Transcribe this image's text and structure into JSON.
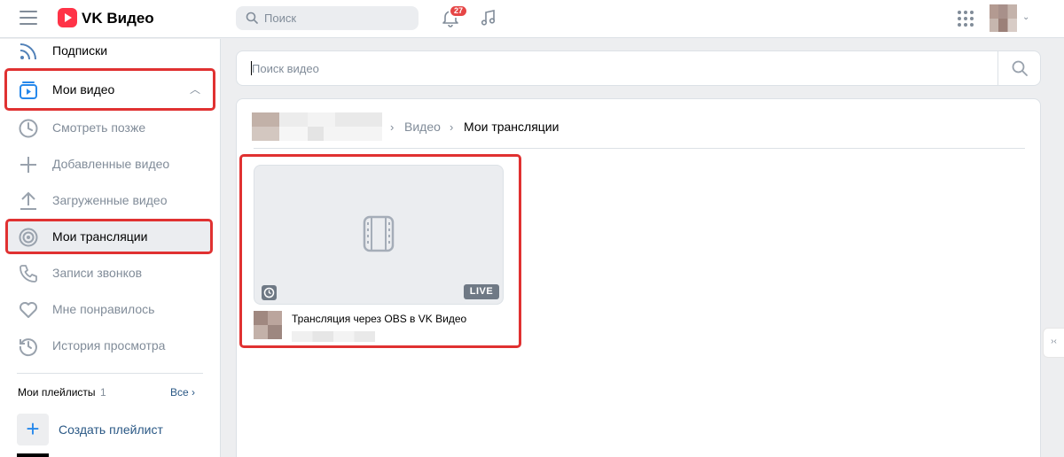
{
  "header": {
    "brand": "VK Видео",
    "search_placeholder": "Поиск",
    "notifications_count": "27",
    "icons": [
      "menu-icon",
      "vk-video-logo",
      "search-icon",
      "bell-icon",
      "music-note-icon",
      "apps-grid-icon",
      "chevron-down-icon"
    ]
  },
  "sidebar": {
    "items": [
      {
        "label": "Подписки",
        "icon": "rss-icon"
      },
      {
        "label": "Мои видео",
        "icon": "video-library-icon"
      },
      {
        "label": "Смотреть позже",
        "icon": "clock-icon"
      },
      {
        "label": "Добавленные видео",
        "icon": "plus-icon"
      },
      {
        "label": "Загруженные видео",
        "icon": "upload-icon"
      },
      {
        "label": "Мои трансляции",
        "icon": "broadcast-icon"
      },
      {
        "label": "Записи звонков",
        "icon": "phone-icon"
      },
      {
        "label": "Мне понравилось",
        "icon": "heart-icon"
      },
      {
        "label": "История просмотра",
        "icon": "history-icon"
      }
    ],
    "playlists": {
      "title": "Мои плейлисты",
      "count": "1",
      "all_label": "Все ›",
      "create_label": "Создать плейлист"
    }
  },
  "main": {
    "search_placeholder": "Поиск видео",
    "breadcrumb": {
      "sep": "›",
      "video": "Видео",
      "current": "Мои трансляции"
    },
    "videos": [
      {
        "title": "Трансляция через OBS в VK Видео",
        "badge": "LIVE"
      }
    ]
  },
  "colors": {
    "accent": "#2688eb",
    "link": "#2a5885",
    "highlight": "#e03131",
    "notification": "#e64646",
    "brand": "#ff3347"
  }
}
